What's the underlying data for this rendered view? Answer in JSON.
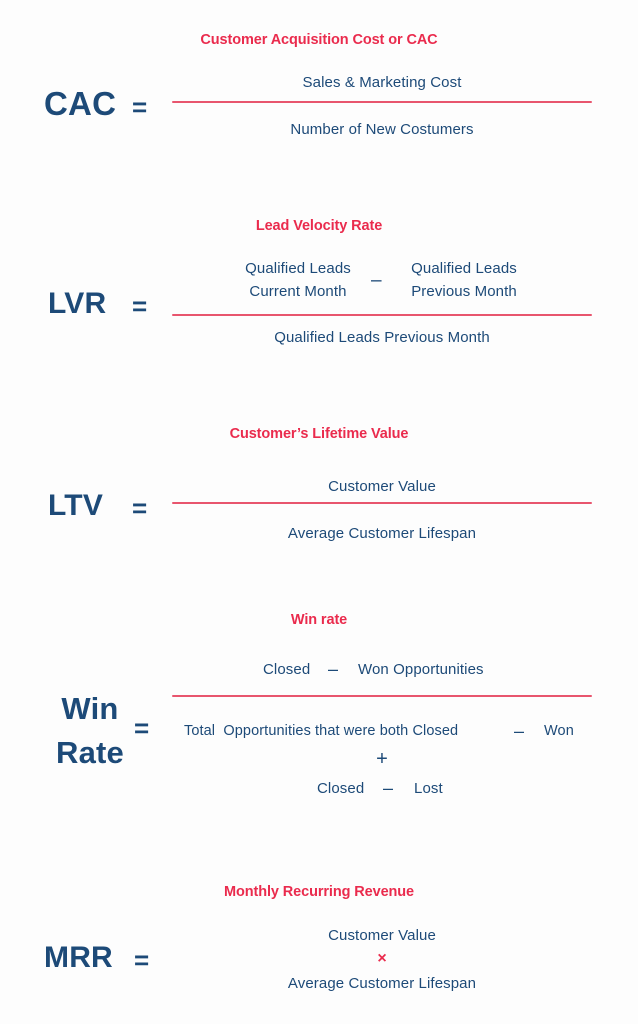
{
  "page": {
    "background_color": "#fdfdfd",
    "accent_red": "#ea2b4d",
    "rule_red": "#e8556e",
    "navy": "#1d4a78"
  },
  "formulas": [
    {
      "id": "cac",
      "heading": "Customer Acquisition Cost or CAC",
      "abbr": "CAC",
      "equals": "=",
      "numerator": "Sales & Marketing Cost",
      "denominator": "Number of New Costumers",
      "has_bar": true
    },
    {
      "id": "lvr",
      "heading": "Lead Velocity Rate",
      "abbr": "LVR",
      "equals": "=",
      "numerator_left": "Qualified Leads\nCurrent Month",
      "numerator_operator": "–",
      "numerator_right": "Qualified Leads\nPrevious Month",
      "denominator": "Qualified Leads Previous Month",
      "has_bar": true
    },
    {
      "id": "ltv",
      "heading": "Customer’s Lifetime Value",
      "abbr": "LTV",
      "equals": "=",
      "numerator": "Customer Value",
      "denominator": "Average Customer Lifespan",
      "has_bar": true
    },
    {
      "id": "win-rate",
      "heading": "Win rate",
      "abbr": "Win\nRate",
      "equals": "=",
      "numerator_left": "Closed",
      "numerator_operator": "–",
      "numerator_right": "Won Opportunities",
      "denominator_line1": "Total  Opportunities that were both Closed",
      "denominator_line1_operator": "–",
      "denominator_line1_tail": "Won",
      "denominator_operator": "+",
      "denominator_line3_left": "Closed",
      "denominator_line3_operator": "–",
      "denominator_line3_right": "Lost",
      "has_bar": true
    },
    {
      "id": "mrr",
      "heading": "Monthly Recurring Revenue",
      "abbr": "MRR",
      "equals": "=",
      "numerator": "Customer Value",
      "operator": "×",
      "denominator": "Average Customer Lifespan",
      "has_bar": false
    }
  ]
}
